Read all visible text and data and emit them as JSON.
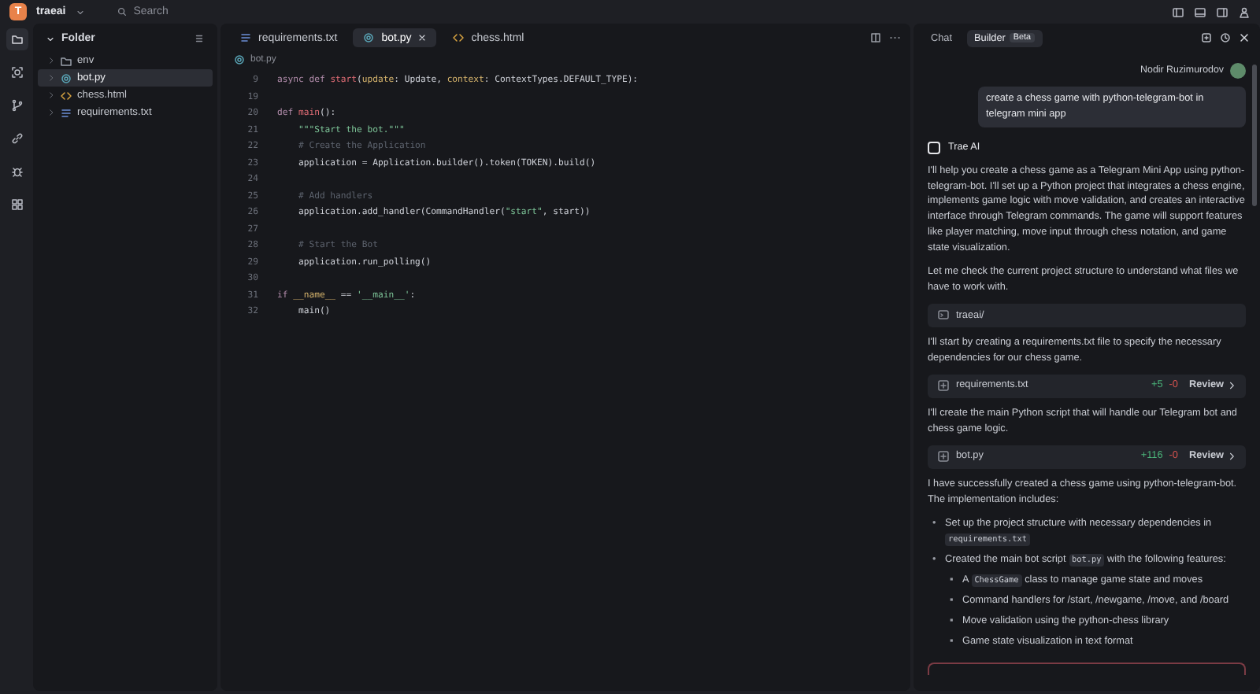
{
  "topbar": {
    "logo": "T",
    "project": "traeai",
    "search": {
      "placeholder": "Search"
    }
  },
  "explorer": {
    "title": "Folder",
    "items": [
      {
        "name": "env",
        "kind": "folder",
        "selected": false
      },
      {
        "name": "bot.py",
        "kind": "python",
        "selected": true
      },
      {
        "name": "chess.html",
        "kind": "html",
        "selected": false
      },
      {
        "name": "requirements.txt",
        "kind": "text",
        "selected": false
      }
    ]
  },
  "editor": {
    "tabs": [
      {
        "label": "requirements.txt",
        "kind": "text",
        "selected": false
      },
      {
        "label": "bot.py",
        "kind": "python",
        "selected": true
      },
      {
        "label": "chess.html",
        "kind": "html",
        "selected": false
      }
    ],
    "breadcrumb": "bot.py",
    "lines": [
      {
        "number": "9",
        "tokens": [
          {
            "text": "async def ",
            "kind": "kw"
          },
          {
            "text": "start",
            "kind": "fn"
          },
          {
            "text": "(",
            "kind": "plain"
          },
          {
            "text": "update",
            "kind": "param"
          },
          {
            "text": ": Update, ",
            "kind": "plain"
          },
          {
            "text": "context",
            "kind": "param"
          },
          {
            "text": ": ContextTypes.DEFAULT_TYPE):",
            "kind": "plain"
          }
        ]
      },
      {
        "number": "19"
      },
      {
        "number": "20",
        "tokens": [
          {
            "text": "def ",
            "kind": "kw"
          },
          {
            "text": "main",
            "kind": "fn"
          },
          {
            "text": "():",
            "kind": "plain"
          }
        ]
      },
      {
        "number": "21",
        "tokens": [
          {
            "text": "    \"\"\"Start the bot.\"\"\"",
            "kind": "str"
          }
        ]
      },
      {
        "number": "22",
        "tokens": [
          {
            "text": "    # Create the Application",
            "kind": "cmt"
          }
        ]
      },
      {
        "number": "23",
        "tokens": [
          {
            "text": "    application = Application.builder().token(TOKEN).build()",
            "kind": "plain"
          }
        ]
      },
      {
        "number": "24"
      },
      {
        "number": "25",
        "tokens": [
          {
            "text": "    # Add handlers",
            "kind": "cmt"
          }
        ]
      },
      {
        "number": "26",
        "tokens": [
          {
            "text": "    application.add_handler(CommandHandler(",
            "kind": "plain"
          },
          {
            "text": "\"start\"",
            "kind": "str"
          },
          {
            "text": ", start))",
            "kind": "plain"
          }
        ]
      },
      {
        "number": "27"
      },
      {
        "number": "28",
        "tokens": [
          {
            "text": "    # Start the Bot",
            "kind": "cmt"
          }
        ]
      },
      {
        "number": "29",
        "tokens": [
          {
            "text": "    application.run_polling()",
            "kind": "plain"
          }
        ]
      },
      {
        "number": "30"
      },
      {
        "number": "31",
        "tokens": [
          {
            "text": "if ",
            "kind": "kw"
          },
          {
            "text": "__name__",
            "kind": "param"
          },
          {
            "text": " == ",
            "kind": "plain"
          },
          {
            "text": "'__main__'",
            "kind": "str"
          },
          {
            "text": ":",
            "kind": "plain"
          }
        ]
      },
      {
        "number": "32",
        "tokens": [
          {
            "text": "    main()",
            "kind": "plain"
          }
        ]
      }
    ]
  },
  "chat": {
    "tabs": [
      {
        "label": "Chat",
        "selected": false
      },
      {
        "label": "Builder",
        "badge": "Beta",
        "selected": true
      }
    ],
    "user": {
      "name": "Nodir Ruzimurodov",
      "message": "create a chess game with python-telegram-bot in telegram mini app"
    },
    "assistant": "Trae AI",
    "blocks": [
      {
        "kind": "paragraph",
        "text": "I'll help you create a chess game as a Telegram Mini App using python-telegram-bot. I'll set up a Python project that integrates a chess engine, implements game logic with move validation, and creates an interactive interface through Telegram commands. The game will support features like player matching, move input through chess notation, and game state visualization."
      },
      {
        "kind": "paragraph",
        "text": "Let me check the current project structure to understand what files we have to work with."
      },
      {
        "kind": "tool",
        "text": "traeai/"
      },
      {
        "kind": "paragraph",
        "text": "I'll start by creating a requirements.txt file to specify the necessary dependencies for our chess game."
      },
      {
        "kind": "file",
        "text": "requirements.txt",
        "added": "+5",
        "removed": "-0",
        "action": "Review"
      },
      {
        "kind": "paragraph",
        "text": "I'll create the main Python script that will handle our Telegram bot and chess game logic."
      },
      {
        "kind": "file",
        "text": "bot.py",
        "added": "+116",
        "removed": "-0",
        "action": "Review"
      },
      {
        "kind": "paragraph",
        "text": "I have successfully created a chess game using python-telegram-bot. The implementation includes:"
      },
      {
        "kind": "list",
        "items": [
          {
            "marker": "•",
            "parts": [
              {
                "text": "Set up the project structure with necessary dependencies in ",
                "kind": "text"
              },
              {
                "text": "requirements.txt",
                "kind": "code"
              }
            ]
          },
          {
            "marker": "•",
            "parts": [
              {
                "text": "Created the main bot script ",
                "kind": "text"
              },
              {
                "text": "bot.py",
                "kind": "code"
              },
              {
                "text": " with the following features:",
                "kind": "text"
              }
            ],
            "children": [
              {
                "marker": "▪",
                "parts": [
                  {
                    "text": "A ",
                    "kind": "text"
                  },
                  {
                    "text": "ChessGame",
                    "kind": "code"
                  },
                  {
                    "text": " class to manage game state and moves",
                    "kind": "text"
                  }
                ]
              },
              {
                "marker": "▪",
                "parts": [
                  {
                    "text": "Command handlers for /start, /newgame, /move, and /board",
                    "kind": "text"
                  }
                ]
              },
              {
                "marker": "▪",
                "parts": [
                  {
                    "text": "Move validation using the python-chess library",
                    "kind": "text"
                  }
                ]
              },
              {
                "marker": "▪",
                "parts": [
                  {
                    "text": "Game state visualization in text format",
                    "kind": "text"
                  }
                ]
              }
            ]
          }
        ]
      },
      {
        "kind": "alert"
      }
    ]
  }
}
